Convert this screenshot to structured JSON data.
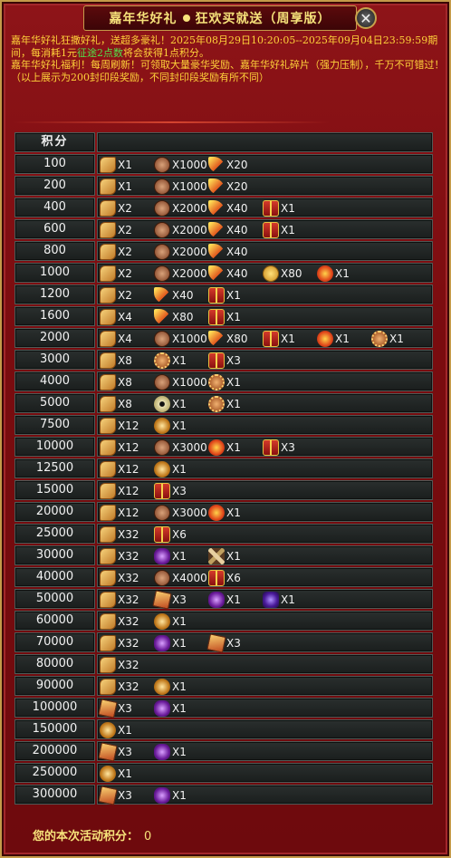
{
  "title": {
    "part1": "嘉年华好礼",
    "part2": "狂欢买就送（周享版）"
  },
  "notice": {
    "line1": "嘉年华好礼狂撒好礼，送超多豪礼！2025年08月29日10:20:05--2025年09月04日23:59:59期间，每消耗1元",
    "line1_green": "征途2点数",
    "line1_tail": "将会获得1点积分。",
    "line2": "嘉年华好礼福利！每周刷新！可领取大量豪华奖励、嘉年华好礼碎片（强力压制），千万不可错过！",
    "line3": "（以上展示为200封印段奖励，不同封印段奖励有所不同）"
  },
  "table": {
    "header": "积分",
    "rows": [
      {
        "score": "100",
        "items": [
          [
            "scroll-icon",
            "X1"
          ],
          [
            "coin-icon",
            "X1000"
          ],
          [
            "feather-icon",
            "X20"
          ]
        ]
      },
      {
        "score": "200",
        "items": [
          [
            "scroll-icon",
            "X1"
          ],
          [
            "coin-icon",
            "X1000"
          ],
          [
            "feather-icon",
            "X20"
          ]
        ]
      },
      {
        "score": "400",
        "items": [
          [
            "scroll-icon",
            "X2"
          ],
          [
            "coin-icon",
            "X2000"
          ],
          [
            "feather-icon",
            "X40"
          ],
          [
            "gift-icon",
            "X1"
          ]
        ]
      },
      {
        "score": "600",
        "items": [
          [
            "scroll-icon",
            "X2"
          ],
          [
            "coin-icon",
            "X2000"
          ],
          [
            "feather-icon",
            "X40"
          ],
          [
            "giftbox-icon",
            "X1"
          ]
        ]
      },
      {
        "score": "800",
        "items": [
          [
            "scroll-icon",
            "X2"
          ],
          [
            "coin-icon",
            "X2000"
          ],
          [
            "feather-icon",
            "X40"
          ]
        ]
      },
      {
        "score": "1000",
        "items": [
          [
            "scroll-icon",
            "X2"
          ],
          [
            "coin-icon",
            "X2000"
          ],
          [
            "feather-icon",
            "X40"
          ],
          [
            "gold-icon",
            "X80"
          ],
          [
            "fire-icon",
            "X1"
          ]
        ]
      },
      {
        "score": "1200",
        "items": [
          [
            "scroll-icon",
            "X2"
          ],
          [
            "feather-icon",
            "X40"
          ],
          [
            "giftbox-icon",
            "X1"
          ]
        ]
      },
      {
        "score": "1600",
        "items": [
          [
            "scroll-icon",
            "X4"
          ],
          [
            "feather-icon",
            "X80"
          ],
          [
            "gift-icon",
            "X1"
          ]
        ]
      },
      {
        "score": "2000",
        "items": [
          [
            "scroll-icon",
            "X4"
          ],
          [
            "coin-icon",
            "X1000"
          ],
          [
            "feather-icon",
            "X80"
          ],
          [
            "gift-icon",
            "X1"
          ],
          [
            "fire-icon",
            "X1"
          ],
          [
            "medal-icon",
            "X1"
          ]
        ]
      },
      {
        "score": "3000",
        "items": [
          [
            "scroll-icon",
            "X8"
          ],
          [
            "medal-icon",
            "X1"
          ],
          [
            "giftbox-icon",
            "X3"
          ]
        ]
      },
      {
        "score": "4000",
        "items": [
          [
            "scroll-icon",
            "X8"
          ],
          [
            "coin-icon",
            "X1000"
          ],
          [
            "medal-icon",
            "X1"
          ]
        ]
      },
      {
        "score": "5000",
        "items": [
          [
            "scroll-icon",
            "X8"
          ],
          [
            "eye-icon",
            "X1"
          ],
          [
            "medal-icon",
            "X1"
          ]
        ]
      },
      {
        "score": "7500",
        "items": [
          [
            "scroll-icon",
            "X12"
          ],
          [
            "orb-icon",
            "X1"
          ]
        ]
      },
      {
        "score": "10000",
        "items": [
          [
            "scroll-icon",
            "X12"
          ],
          [
            "coin-icon",
            "X3000"
          ],
          [
            "fire-icon",
            "X1"
          ],
          [
            "gift-icon",
            "X3"
          ]
        ]
      },
      {
        "score": "12500",
        "items": [
          [
            "scroll-icon",
            "X12"
          ],
          [
            "orb-icon",
            "X1"
          ]
        ]
      },
      {
        "score": "15000",
        "items": [
          [
            "scroll-icon",
            "X12"
          ],
          [
            "gift-icon",
            "X3"
          ]
        ]
      },
      {
        "score": "20000",
        "items": [
          [
            "scroll-icon",
            "X12"
          ],
          [
            "coin-icon",
            "X3000"
          ],
          [
            "fire-icon",
            "X1"
          ]
        ]
      },
      {
        "score": "25000",
        "items": [
          [
            "scroll-icon",
            "X32"
          ],
          [
            "gift-icon",
            "X6"
          ]
        ]
      },
      {
        "score": "30000",
        "items": [
          [
            "scroll-icon",
            "X32"
          ],
          [
            "purple-icon",
            "X1"
          ],
          [
            "cross-icon",
            "X1"
          ]
        ]
      },
      {
        "score": "40000",
        "items": [
          [
            "scroll-icon",
            "X32"
          ],
          [
            "coin-icon",
            "X4000"
          ],
          [
            "gift-icon",
            "X6"
          ]
        ]
      },
      {
        "score": "50000",
        "items": [
          [
            "scroll-icon",
            "X32"
          ],
          [
            "card-icon",
            "X3"
          ],
          [
            "purple-icon",
            "X1"
          ],
          [
            "purple2-icon",
            "X1"
          ]
        ]
      },
      {
        "score": "60000",
        "items": [
          [
            "scroll-icon",
            "X32"
          ],
          [
            "orb-icon",
            "X1"
          ]
        ]
      },
      {
        "score": "70000",
        "items": [
          [
            "scroll-icon",
            "X32"
          ],
          [
            "purple-icon",
            "X1"
          ],
          [
            "card-icon",
            "X3"
          ]
        ]
      },
      {
        "score": "80000",
        "items": [
          [
            "scroll-icon",
            "X32"
          ]
        ]
      },
      {
        "score": "90000",
        "items": [
          [
            "scroll-icon",
            "X32"
          ],
          [
            "orb-icon",
            "X1"
          ]
        ]
      },
      {
        "score": "100000",
        "items": [
          [
            "card-icon",
            "X3"
          ],
          [
            "purple-icon",
            "X1"
          ]
        ]
      },
      {
        "score": "150000",
        "items": [
          [
            "orb-icon",
            "X1"
          ]
        ]
      },
      {
        "score": "200000",
        "items": [
          [
            "card-icon",
            "X3"
          ],
          [
            "purple-icon",
            "X1"
          ]
        ]
      },
      {
        "score": "250000",
        "items": [
          [
            "orb-icon",
            "X1"
          ]
        ]
      },
      {
        "score": "300000",
        "items": [
          [
            "card-icon",
            "X3"
          ],
          [
            "purple-icon",
            "X1"
          ]
        ]
      }
    ]
  },
  "footer": {
    "label": "您的本次活动积分：",
    "value": "0"
  }
}
